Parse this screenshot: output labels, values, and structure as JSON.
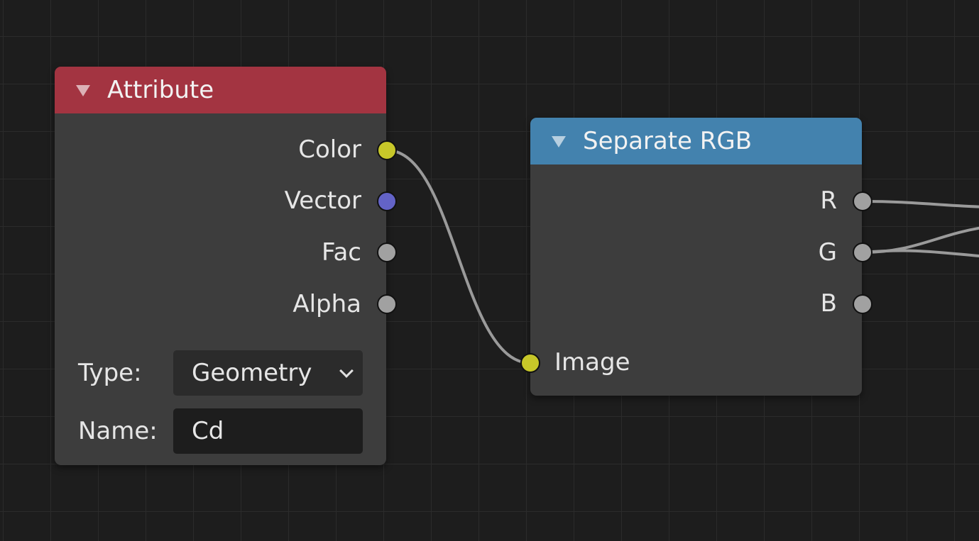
{
  "colors": {
    "attribute_header": "#a33441",
    "separate_rgb_header": "#4382ae",
    "node_body": "#3d3d3d",
    "socket_color": "#c7c729",
    "socket_vector": "#6363c7",
    "socket_float": "#a1a1a1",
    "wire": "#9a9a9a"
  },
  "attribute_node": {
    "title": "Attribute",
    "outputs": [
      {
        "label": "Color",
        "socket_type": "color"
      },
      {
        "label": "Vector",
        "socket_type": "vector"
      },
      {
        "label": "Fac",
        "socket_type": "float"
      },
      {
        "label": "Alpha",
        "socket_type": "float"
      }
    ],
    "type_label": "Type:",
    "type_value": "Geometry",
    "name_label": "Name:",
    "name_value": "Cd"
  },
  "separate_rgb_node": {
    "title": "Separate RGB",
    "outputs": [
      {
        "label": "R",
        "socket_type": "float"
      },
      {
        "label": "G",
        "socket_type": "float"
      },
      {
        "label": "B",
        "socket_type": "float"
      }
    ],
    "inputs": [
      {
        "label": "Image",
        "socket_type": "color"
      }
    ]
  },
  "icons": {
    "collapse": "triangle-down-icon",
    "dropdown": "chevron-down-icon"
  }
}
